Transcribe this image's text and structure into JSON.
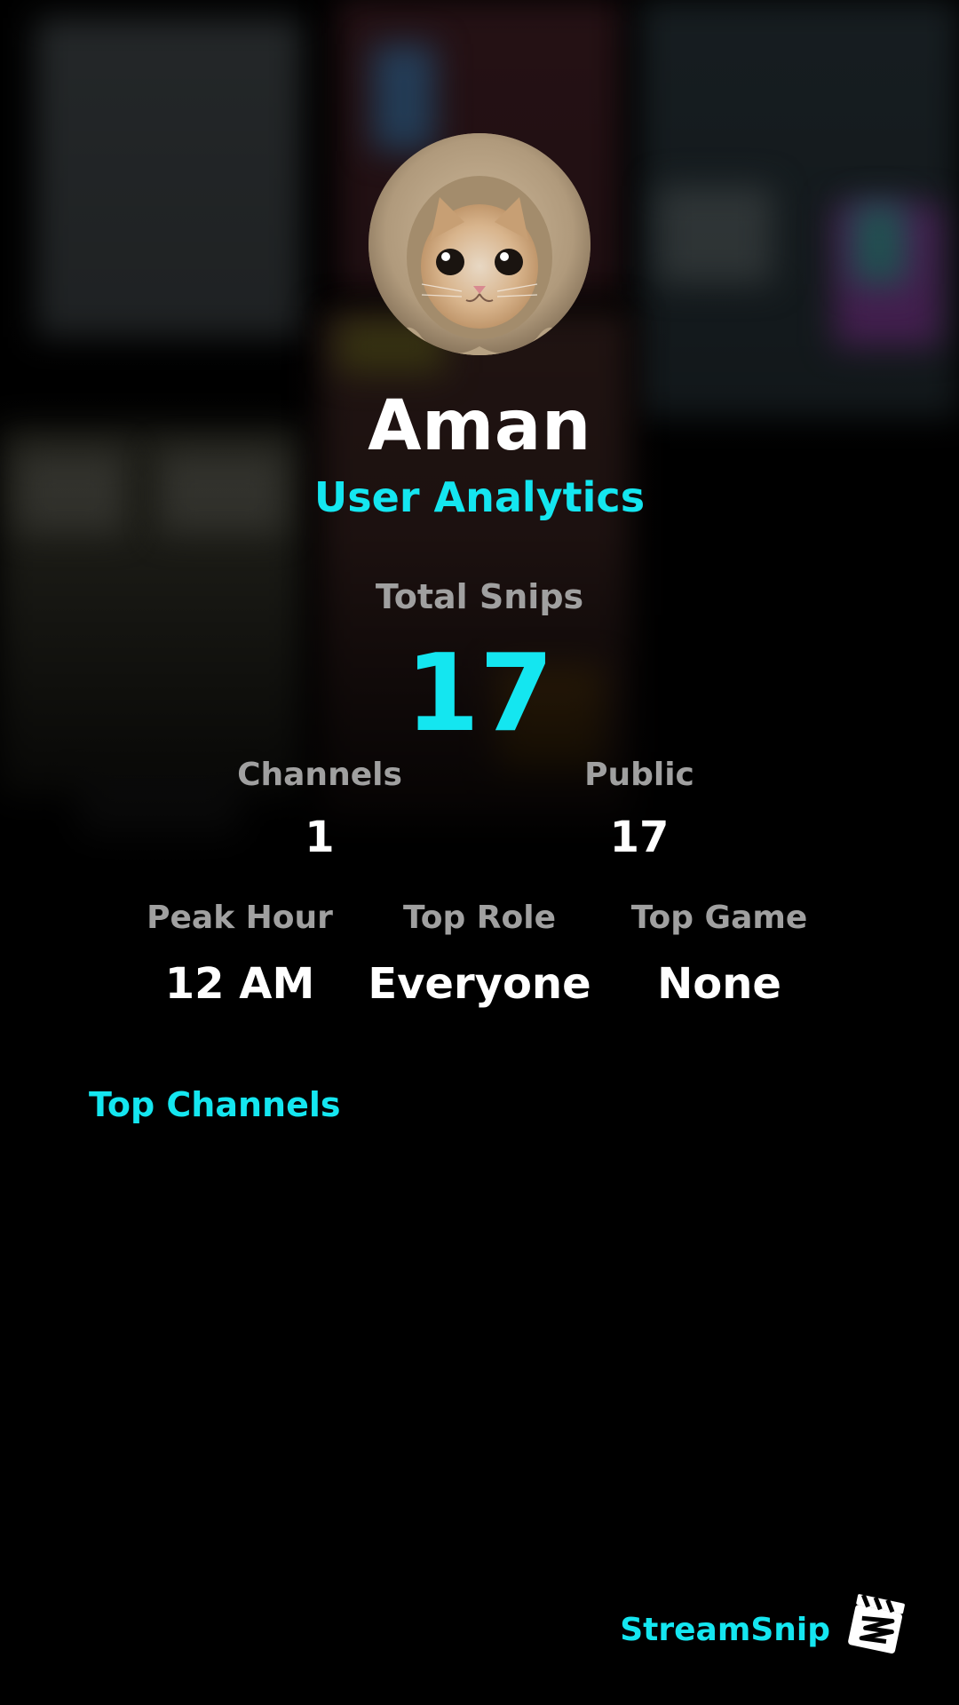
{
  "profile": {
    "name": "Aman",
    "subtitle": "User Analytics"
  },
  "stats": {
    "total": {
      "label": "Total Snips",
      "value": "17"
    },
    "channels": {
      "label": "Channels",
      "value": "1"
    },
    "public": {
      "label": "Public",
      "value": "17"
    },
    "peak_hour": {
      "label": "Peak Hour",
      "value": "12 AM"
    },
    "top_role": {
      "label": "Top Role",
      "value": "Everyone"
    },
    "top_game": {
      "label": "Top Game",
      "value": "None"
    }
  },
  "sections": {
    "top_channels": "Top Channels"
  },
  "brand": {
    "name": "StreamSnip",
    "logo_icon": "clapperboard-logo-icon"
  },
  "colors": {
    "accent": "#14e6f0",
    "label": "#a0a0a0",
    "background": "#000000"
  }
}
